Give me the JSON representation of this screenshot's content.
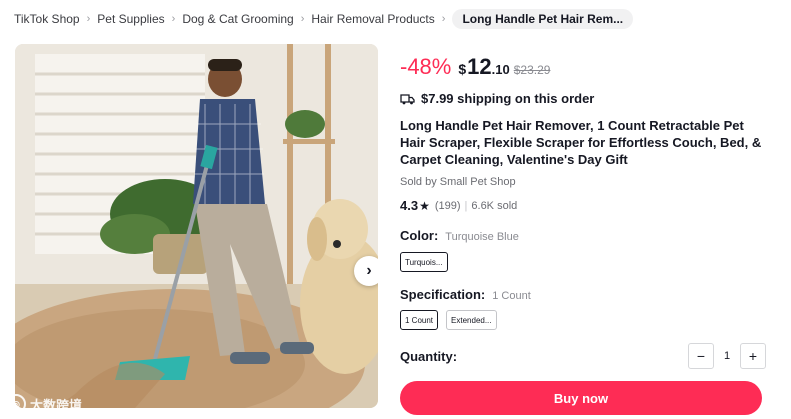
{
  "breadcrumb": {
    "items": [
      "TikTok Shop",
      "Pet Supplies",
      "Dog & Cat Grooming",
      "Hair Removal Products"
    ],
    "current": "Long Handle Pet Hair Rem..."
  },
  "gallery": {
    "next_icon": "chevron-right-icon",
    "watermark": "大数跨境"
  },
  "price": {
    "discount": "-48%",
    "currency": "$",
    "integer": "12",
    "decimal": ".10",
    "original": "$23.29"
  },
  "shipping": {
    "icon": "truck-icon",
    "text": "$7.99 shipping on this order"
  },
  "product": {
    "title": "Long Handle Pet Hair Remover, 1 Count Retractable Pet Hair Scraper, Flexible Scraper for Effortless Couch, Bed, & Carpet Cleaning, Valentine's Day Gift",
    "seller": "Sold by Small Pet Shop"
  },
  "rating": {
    "score": "4.3",
    "star": "★",
    "reviews": "(199)",
    "separator": "|",
    "sold": "6.6K sold"
  },
  "color": {
    "label": "Color:",
    "value": "Turquoise Blue",
    "options": [
      "Turquois..."
    ]
  },
  "specification": {
    "label": "Specification:",
    "value": "1 Count",
    "options": [
      "1 Count",
      "Extended..."
    ]
  },
  "quantity": {
    "label": "Quantity:",
    "minus": "−",
    "value": "1",
    "plus": "+"
  },
  "buy_button": "Buy now",
  "colors": {
    "accent": "#fe2c55",
    "text": "#161823",
    "muted": "#8a8b91"
  }
}
